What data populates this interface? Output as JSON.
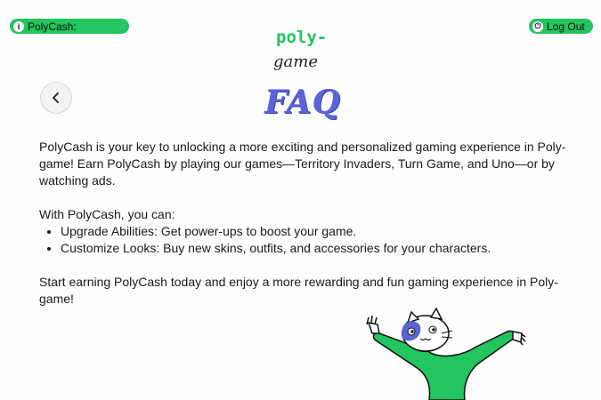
{
  "header": {
    "polycash_label": "PolyCash:",
    "polycash_icon": "info-icon",
    "logout_label": "Log Out",
    "logout_icon": "logout-icon",
    "logo_top": "poly-",
    "logo_bottom": "game",
    "accent_color": "#22c55e"
  },
  "page": {
    "title": "FAQ",
    "title_color": "#5b63d6",
    "back_icon": "chevron-left-icon"
  },
  "faq": {
    "intro": "PolyCash is your key to unlocking a more exciting and personalized gaming experience in Poly-game! Earn PolyCash by playing our games—Territory Invaders, Turn Game, and Uno—or by watching ads.",
    "list_intro": "With PolyCash, you can:",
    "bullets": [
      "Upgrade Abilities: Get power-ups to boost your game.",
      "Customize Looks: Buy new skins, outfits, and accessories for your characters."
    ],
    "outro": "Start earning PolyCash today and enjoy a more rewarding and fun gaming experience in Poly-game!"
  },
  "illustration": {
    "name": "cat-mascot-illustration"
  }
}
